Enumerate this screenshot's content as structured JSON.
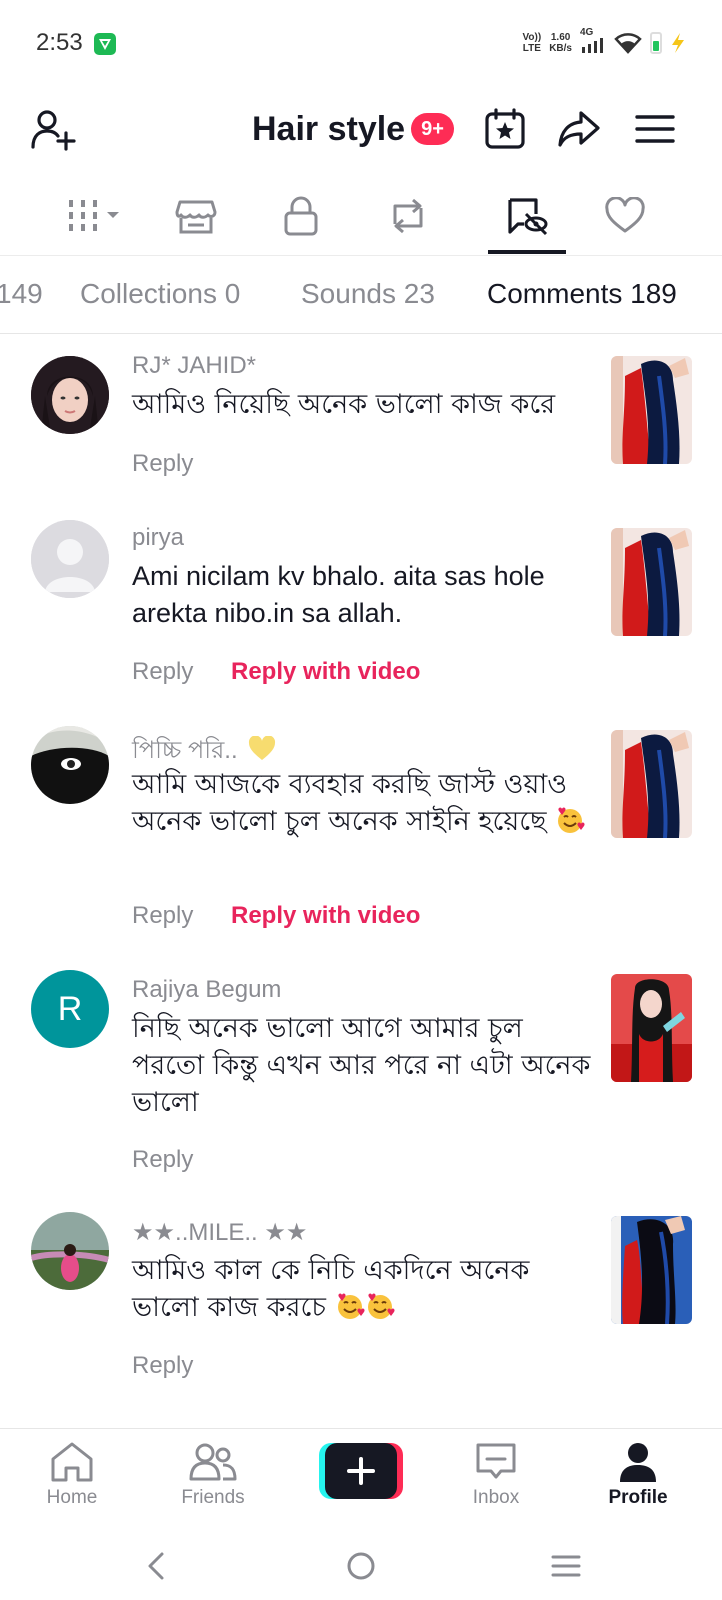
{
  "status_bar": {
    "time": "2:53",
    "volte": "Vo)) LTE",
    "speed": "1.60",
    "speed_unit": "KB/s",
    "network": "4G"
  },
  "header": {
    "title": "Hair style",
    "badge": "9+"
  },
  "icon_tabs": [
    "videos-grid-icon",
    "shop-icon",
    "lock-icon",
    "repost-icon",
    "comments-hidden-icon",
    "heart-icon"
  ],
  "text_tabs": [
    {
      "label": "149",
      "active": false
    },
    {
      "label": "Collections 0",
      "active": false
    },
    {
      "label": "Sounds 23",
      "active": false
    },
    {
      "label": "Comments 189",
      "active": true
    }
  ],
  "comments": [
    {
      "username": "RJ* JAHID*",
      "text": "আমিও নিয়েছি অনেক ভালো কাজ করে",
      "reply": "Reply",
      "reply_with_video": ""
    },
    {
      "username": "pirya",
      "text": "Ami nicilam kv bhalo. aita sas hole arekta nibo.in sa allah.",
      "reply": "Reply",
      "reply_with_video": "Reply with video"
    },
    {
      "username": "পিচ্চি পরি..",
      "text": "আমি আজকে ব্যবহার করছি জাস্ট ওয়াও অনেক ভালো চুল অনেক সাইনি হয়েছে",
      "reply": "Reply",
      "reply_with_video": "Reply with video"
    },
    {
      "username": "Rajiya Begum",
      "avatar_letter": "R",
      "text": "নিছি অনেক ভালো আগে আমার চুল পরতো কিন্তু এখন আর পরে না এটা অনেক ভালো",
      "reply": "Reply",
      "reply_with_video": ""
    },
    {
      "username": "★★..MILE.. ★★",
      "text": "আমিও কাল কে নিচি একদিনে অনেক ভালো কাজ করচে",
      "reply": "Reply",
      "reply_with_video": ""
    }
  ],
  "bottom_nav": [
    {
      "label": "Home",
      "icon": "home-icon",
      "active": false
    },
    {
      "label": "Friends",
      "icon": "friends-icon",
      "active": false
    },
    {
      "label": "",
      "icon": "plus-icon",
      "active": false
    },
    {
      "label": "Inbox",
      "icon": "inbox-icon",
      "active": false
    },
    {
      "label": "Profile",
      "icon": "profile-icon",
      "active": true
    }
  ],
  "colors": {
    "accent": "#fe2c55",
    "reply_video": "#e8245c",
    "muted": "#8a8b91",
    "text": "#161823"
  }
}
